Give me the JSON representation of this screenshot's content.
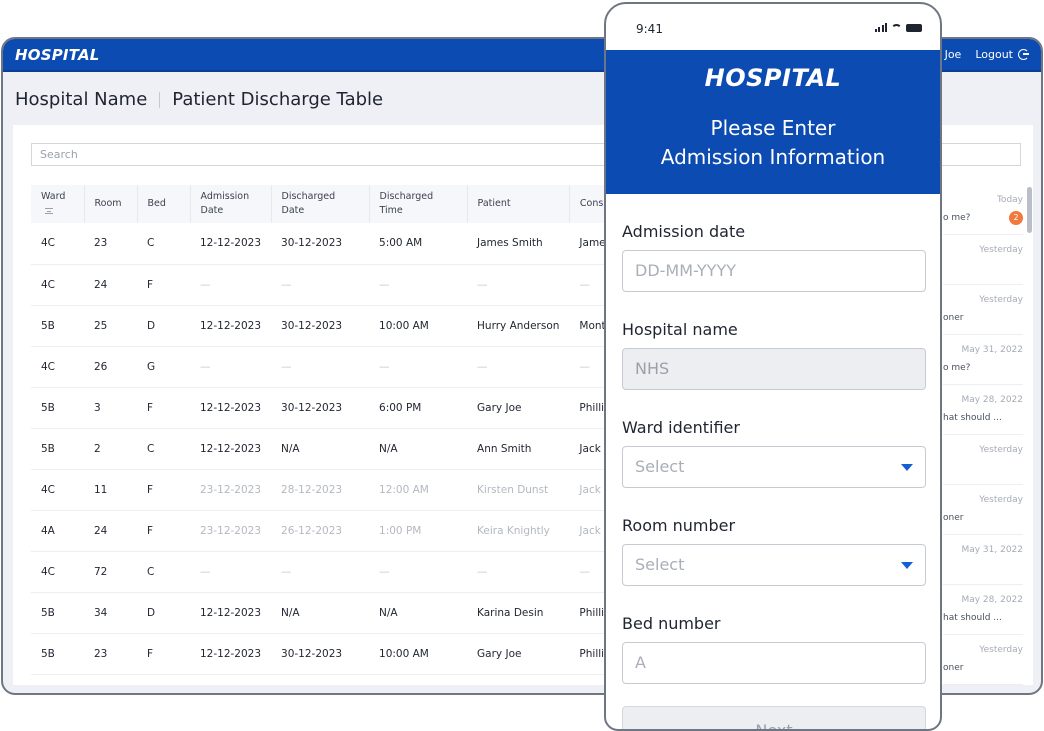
{
  "app": {
    "logo": "HOSPITAL",
    "user": "Joe",
    "logout_label": "Logout"
  },
  "page": {
    "hospital": "Hospital Name",
    "title": "Patient Discharge Table"
  },
  "search": {
    "placeholder": "Search"
  },
  "table": {
    "headers": [
      "Ward",
      "Room",
      "Bed",
      "Admission Date",
      "Discharged Date",
      "Discharged Time",
      "Patient",
      "Consultant"
    ],
    "rows": [
      [
        "4C",
        "23",
        "C",
        "12-12-2023",
        "30-12-2023",
        "5:00 AM",
        "James Smith",
        "James"
      ],
      [
        "4C",
        "24",
        "F",
        "—",
        "—",
        "—",
        "—",
        "—"
      ],
      [
        "5B",
        "25",
        "D",
        "12-12-2023",
        "30-12-2023",
        "10:00 AM",
        "Hurry Anderson",
        "Montgo"
      ],
      [
        "4C",
        "26",
        "G",
        "—",
        "—",
        "—",
        "—",
        "—"
      ],
      [
        "5B",
        "3",
        "F",
        "12-12-2023",
        "30-12-2023",
        "6:00 PM",
        "Gary Joe",
        "Phillip J"
      ],
      [
        "5B",
        "2",
        "C",
        "12-12-2023",
        "N/A",
        "N/A",
        "Ann Smith",
        "Jack We"
      ],
      [
        "4C",
        "11",
        "F",
        "23-12-2023",
        "28-12-2023",
        "12:00 AM",
        "Kirsten Dunst",
        "Jack We"
      ],
      [
        "4A",
        "24",
        "F",
        "23-12-2023",
        "26-12-2023",
        "1:00 PM",
        "Keira Knightly",
        "Jack We"
      ],
      [
        "4C",
        "72",
        "C",
        "—",
        "—",
        "—",
        "—",
        "—"
      ],
      [
        "5B",
        "34",
        "D",
        "12-12-2023",
        "N/A",
        "N/A",
        "Karina Desin",
        "Phillip J"
      ],
      [
        "5B",
        "23",
        "F",
        "12-12-2023",
        "30-12-2023",
        "10:00 AM",
        "Gary Joe",
        "Phillip J"
      ]
    ],
    "muted_rows": [
      6,
      7
    ]
  },
  "messages": [
    {
      "time": "Today",
      "text": "o me?",
      "badge": "2"
    },
    {
      "time": "Yesterday",
      "text": ""
    },
    {
      "time": "Yesterday",
      "text": "oner"
    },
    {
      "time": "May 31, 2022",
      "text": "o me?"
    },
    {
      "time": "May 28, 2022",
      "text": "hat should ..."
    },
    {
      "time": "Yesterday",
      "text": ""
    },
    {
      "time": "Yesterday",
      "text": "oner"
    },
    {
      "time": "May 31, 2022",
      "text": ""
    },
    {
      "time": "May 28, 2022",
      "text": "hat should ..."
    },
    {
      "time": "Yesterday",
      "text": "oner"
    }
  ],
  "phone": {
    "clock": "9:41",
    "logo": "HOSPITAL",
    "title_line1": "Please Enter",
    "title_line2": "Admission Information",
    "fields": {
      "admission_date": {
        "label": "Admission date",
        "placeholder": "DD-MM-YYYY"
      },
      "hospital_name": {
        "label": "Hospital name",
        "value": "NHS"
      },
      "ward": {
        "label": "Ward identifier",
        "placeholder": "Select"
      },
      "room": {
        "label": "Room number",
        "placeholder": "Select"
      },
      "bed": {
        "label": "Bed number",
        "placeholder": "A"
      }
    },
    "next_label": "Next"
  }
}
